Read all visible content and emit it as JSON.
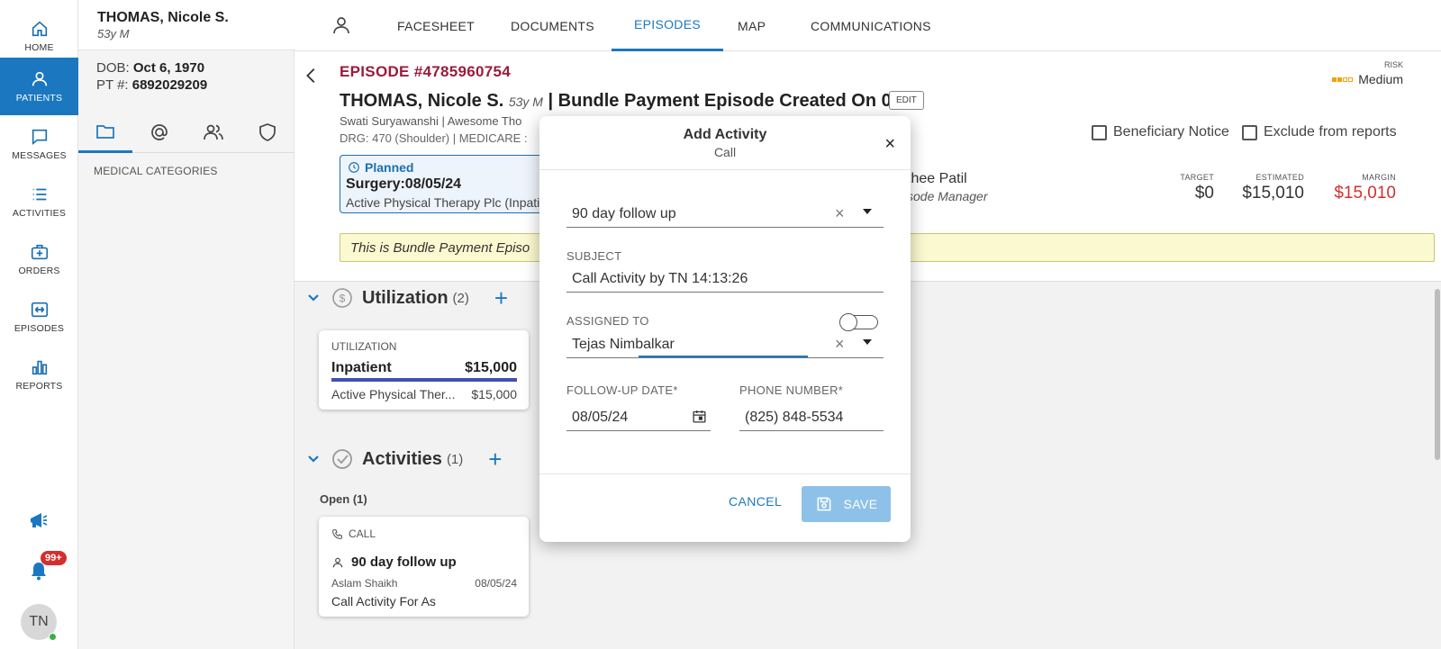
{
  "nav": {
    "items": [
      {
        "label": "HOME",
        "icon": "home-icon"
      },
      {
        "label": "PATIENTS",
        "icon": "person-icon",
        "active": true
      },
      {
        "label": "MESSAGES",
        "icon": "chat-icon"
      },
      {
        "label": "ACTIVITIES",
        "icon": "list-icon"
      },
      {
        "label": "ORDERS",
        "icon": "medical-bag-icon"
      },
      {
        "label": "EPISODES",
        "icon": "episodes-icon"
      },
      {
        "label": "REPORTS",
        "icon": "bar-chart-icon"
      }
    ],
    "notification_badge": "99+",
    "avatar_initials": "TN"
  },
  "patient": {
    "name": "THOMAS, Nicole S.",
    "age_sex": "53y M",
    "dob_label": "DOB:",
    "dob": "Oct 6, 1970",
    "pt_label": "PT #:",
    "pt_number": "6892029209",
    "medical_categories": "MEDICAL CATEGORIES"
  },
  "tabs": [
    "FACESHEET",
    "DOCUMENTS",
    "EPISODES",
    "MAP",
    "COMMUNICATIONS"
  ],
  "active_tab": "EPISODES",
  "episode": {
    "number": "EPISODE #4785960754",
    "patient_name": "THOMAS, Nicole S.",
    "age": "53y M",
    "title_rest": "| Bundle Payment Episode Created On 08...",
    "edit_label": "EDIT",
    "sub1": "Swati Suryawanshi  |  Awesome Tho",
    "sub2": "DRG: 470 (Shoulder)  |   MEDICARE :",
    "risk_label": "RISK",
    "risk_value": "Medium",
    "beneficiary_notice": "Beneficiary Notice",
    "exclude_reports": "Exclude from reports",
    "planned_label": "Planned",
    "planned_surgery": "Surgery:08/05/24",
    "planned_provider": "Active Physical Therapy Plc (Inpatie",
    "manager_name": "thee Patil",
    "manager_role": "sode Manager",
    "target_label": "TARGET",
    "target_value": "$0",
    "estimated_label": "ESTIMATED",
    "estimated_value": "$15,010",
    "margin_label": "MARGIN",
    "margin_value": "$15,010",
    "notice_text": "This is Bundle Payment Episo"
  },
  "utilization": {
    "title": "Utilization",
    "count": "(2)",
    "card_label": "UTILIZATION",
    "card_type": "Inpatient",
    "card_amount": "$15,000",
    "card_provider": "Active Physical Ther...",
    "card_provider_amount": "$15,000"
  },
  "activities": {
    "title": "Activities",
    "count": "(1)",
    "open_label": "Open (1)",
    "card_type": "CALL",
    "card_title": "90 day follow up",
    "card_person": "Aslam Shaikh",
    "card_date": "08/05/24",
    "card_desc": "Call Activity For As"
  },
  "dialog": {
    "title": "Add Activity",
    "subtitle": "Call",
    "close": "×",
    "template_value": "90 day follow up",
    "subject_label": "SUBJECT",
    "subject_value": "Call Activity by TN 14:13:26",
    "assigned_label": "ASSIGNED TO",
    "assigned_value": "Tejas Nimbalkar",
    "followup_label": "FOLLOW-UP DATE*",
    "followup_value": "08/05/24",
    "phone_label": "PHONE NUMBER*",
    "phone_value": "(825) 848-5534",
    "cancel_label": "CANCEL",
    "save_label": "SAVE"
  },
  "colors": {
    "accent": "#1b78c0",
    "episode_number": "#9b1b3c",
    "margin_red": "#d32f2f",
    "save_disabled": "#8ec1e8"
  }
}
